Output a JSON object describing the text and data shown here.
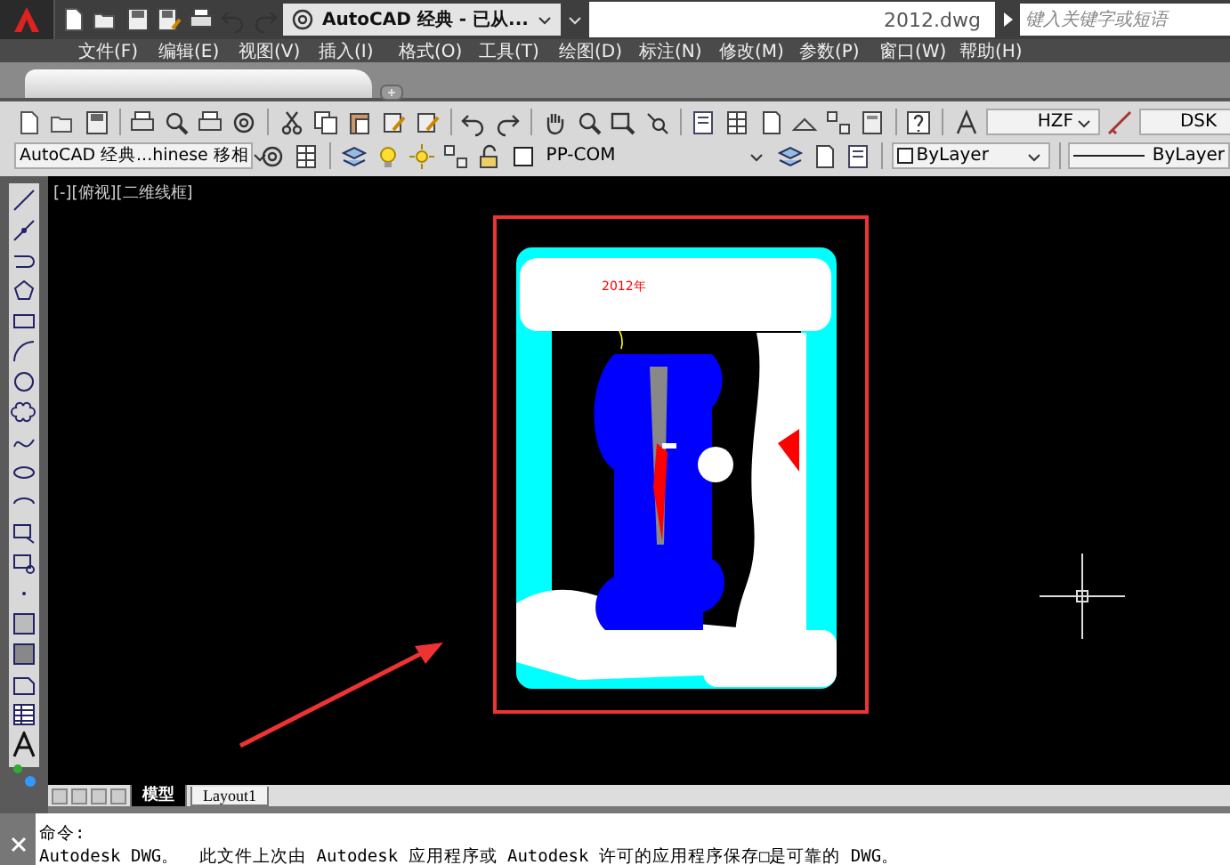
{
  "title_bar": {
    "workspace": "AutoCAD 经典 - 已从...",
    "file_name": "2012.dwg",
    "search": {
      "placeholder": "键入关键字或短语"
    }
  },
  "menu_bar": [
    "文件(F)",
    "编辑(E)",
    "视图(V)",
    "插入(I)",
    "格式(O)",
    "工具(T)",
    "绘图(D)",
    "标注(N)",
    "修改(M)",
    "参数(P)",
    "窗口(W)",
    "帮助(H)"
  ],
  "toolbar_1": {
    "text_style": "HZF",
    "dim_style": "DSK"
  },
  "toolbar_2": {
    "workspace": "AutoCAD 经典...hinese 移相",
    "layer": "PP-COM",
    "color_setting": "ByLayer",
    "linetype": "ByLayer"
  },
  "viewport": {
    "label": "[-][俯视][二维线框]",
    "drawing_text": "2012年"
  },
  "layout_tabs": [
    {
      "label": "模型",
      "selected": true
    },
    {
      "label": "Layout1",
      "selected": false
    }
  ],
  "command_line": {
    "prompt": "命令:",
    "message": "Autodesk DWG。  此文件上次由 Autodesk 应用程序或 Autodesk 许可的应用程序保存□是可靠的 DWG。"
  }
}
